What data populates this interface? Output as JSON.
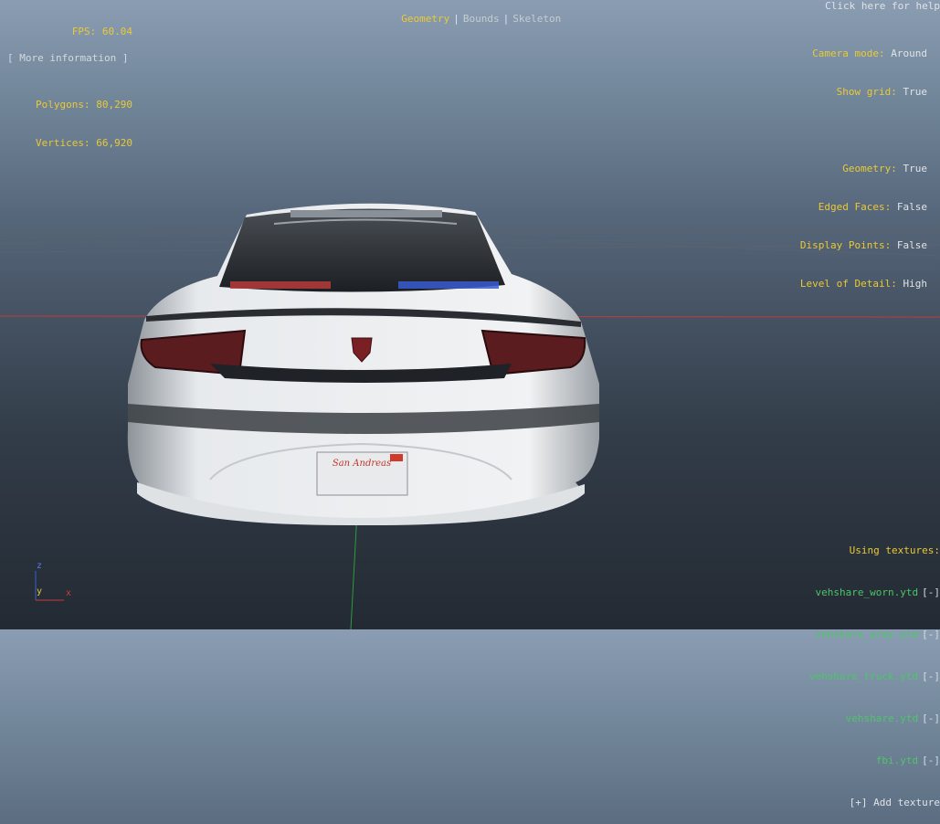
{
  "stats": {
    "fps_label": "FPS:",
    "fps_value": "60.04",
    "polygons_label": "Polygons:",
    "polygons_value": "80,290",
    "vertices_label": "Vertices:",
    "vertices_value": "66,920"
  },
  "more_info_label": "[ More information ]",
  "view_modes": {
    "geometry": "Geometry",
    "bounds": "Bounds",
    "skeleton": "Skeleton",
    "separator": "|"
  },
  "help_label": "Click here for help",
  "settings": {
    "camera_mode_label": "Camera mode:",
    "camera_mode_value": "Around",
    "show_grid_label": "Show grid:",
    "show_grid_value": "True",
    "geometry_label": "Geometry:",
    "geometry_value": "True",
    "edged_faces_label": "Edged Faces:",
    "edged_faces_value": "False",
    "display_points_label": "Display Points:",
    "display_points_value": "False",
    "lod_label": "Level of Detail:",
    "lod_value": "High"
  },
  "textures": {
    "heading": "Using textures:",
    "items": [
      "vehshare_worn.ytd",
      "vehshare_army.ytd",
      "vehshare_truck.ytd",
      "vehshare.ytd",
      "fbi.ytd"
    ],
    "remove_label": "[-]",
    "add_label": "[+] Add texture"
  },
  "axes": {
    "z": "z",
    "y": "y",
    "x": "x"
  },
  "plate_text": "San Andreas",
  "colors": {
    "hud_label": "#e8c93a",
    "hud_value": "#dfe3e8",
    "texture_link": "#4ec46a"
  }
}
